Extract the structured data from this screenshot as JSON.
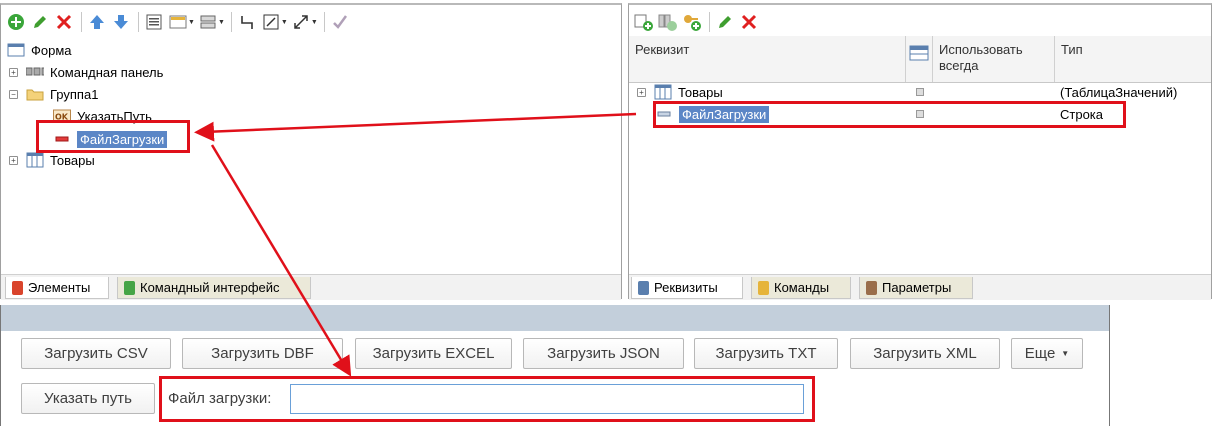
{
  "left_panel": {
    "tree": [
      {
        "label": "Форма"
      },
      {
        "label": "Командная панель"
      },
      {
        "label": "Группа1"
      },
      {
        "label": "УказатьПуть"
      },
      {
        "label": "ФайлЗагрузки"
      },
      {
        "label": "Товары"
      }
    ],
    "tabs": [
      {
        "label": "Элементы"
      },
      {
        "label": "Командный интерфейс"
      }
    ]
  },
  "right_panel": {
    "columns": {
      "rekvizit": "Реквизит",
      "use_always": "Использовать всегда",
      "type": "Тип"
    },
    "rows": [
      {
        "name": "Товары",
        "type": "(ТаблицаЗначений)"
      },
      {
        "name": "ФайлЗагрузки",
        "type": "Строка"
      }
    ],
    "tabs": [
      {
        "label": "Реквизиты"
      },
      {
        "label": "Команды"
      },
      {
        "label": "Параметры"
      }
    ]
  },
  "form": {
    "buttons": [
      {
        "label": "Загрузить CSV"
      },
      {
        "label": "Загрузить DBF"
      },
      {
        "label": "Загрузить EXCEL"
      },
      {
        "label": "Загрузить JSON"
      },
      {
        "label": "Загрузить TXT"
      },
      {
        "label": "Загрузить XML"
      },
      {
        "label": "Еще"
      }
    ],
    "path_button": "Указать путь",
    "file_label": "Файл загрузки:",
    "file_value": ""
  },
  "colors": {
    "selection": "#5b86c6",
    "annotation_red": "#e0101a",
    "header_band": "#c3cfdb"
  }
}
